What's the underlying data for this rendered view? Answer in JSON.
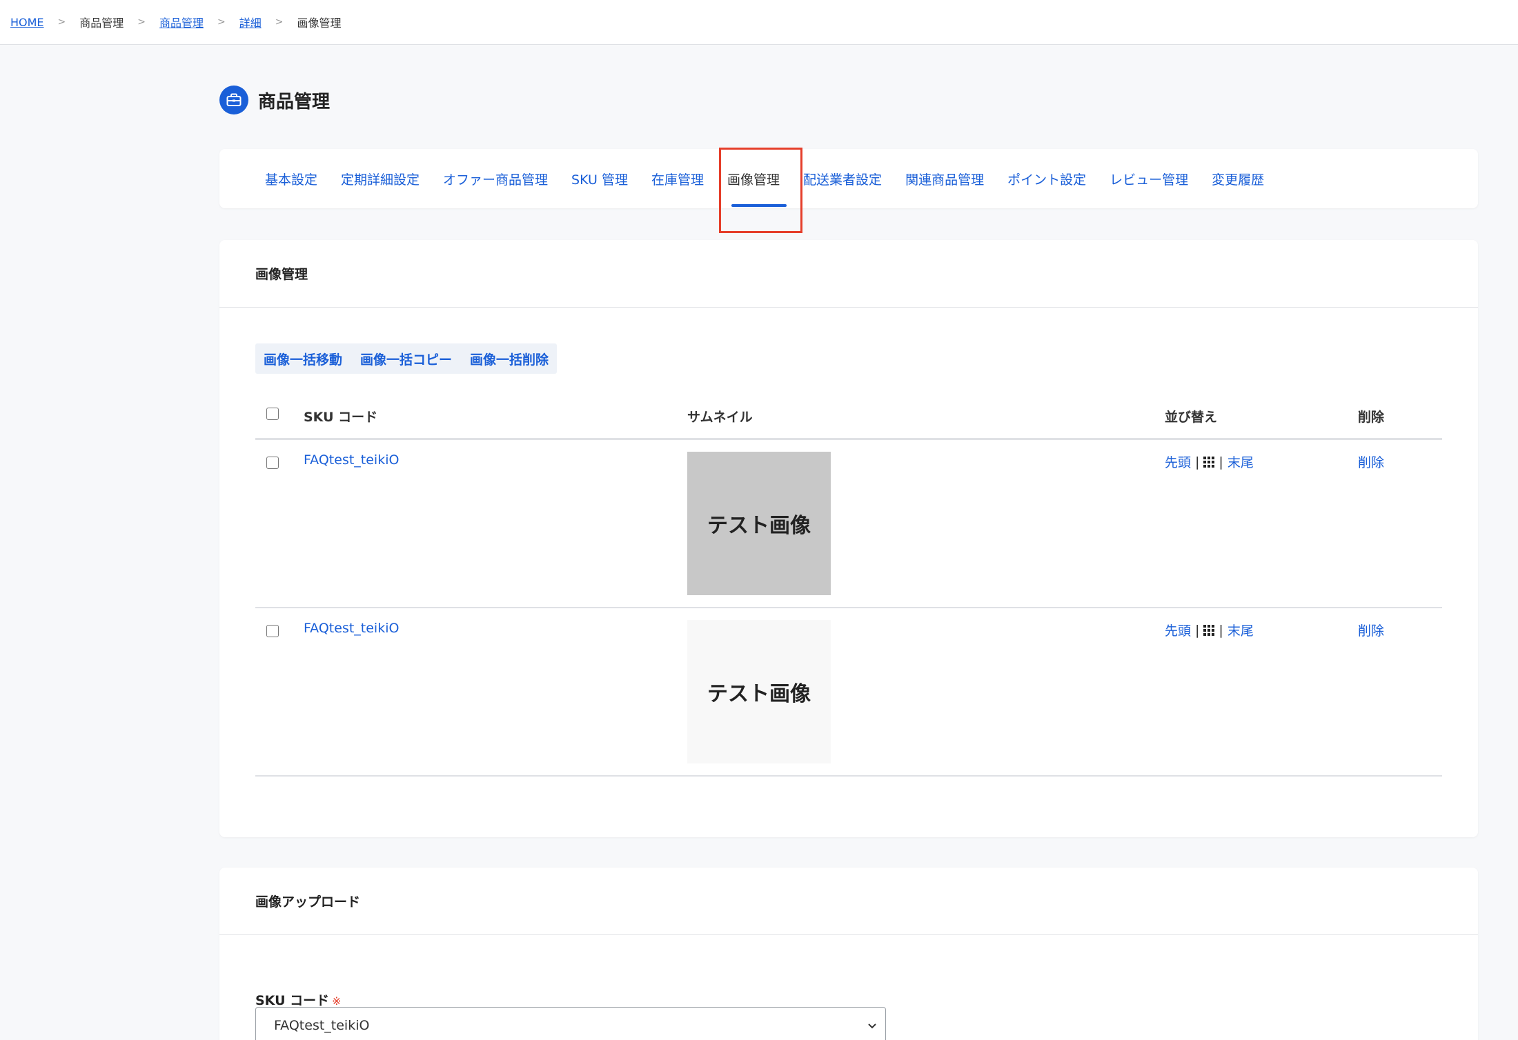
{
  "breadcrumb": {
    "home": "HOME",
    "sep": ">",
    "item1": "商品管理",
    "item2": "商品管理",
    "item3": "詳細",
    "item4": "画像管理"
  },
  "page": {
    "title": "商品管理",
    "icon": "briefcase-icon"
  },
  "tabs": [
    {
      "label": "基本設定"
    },
    {
      "label": "定期詳細設定"
    },
    {
      "label": "オファー商品管理"
    },
    {
      "label": "SKU 管理"
    },
    {
      "label": "在庫管理"
    },
    {
      "label": "画像管理"
    },
    {
      "label": "配送業者設定"
    },
    {
      "label": "関連商品管理"
    },
    {
      "label": "ポイント設定"
    },
    {
      "label": "レビュー管理"
    },
    {
      "label": "変更履歴"
    }
  ],
  "image_section": {
    "title": "画像管理",
    "bulk_move": "画像一括移動",
    "bulk_copy": "画像一括コピー",
    "bulk_delete": "画像一括削除",
    "headers": {
      "sku": "SKU コード",
      "thumb": "サムネイル",
      "sort": "並び替え",
      "delete": "削除"
    },
    "rows": [
      {
        "sku": "FAQtest_teikiO",
        "thumb_text": "テスト画像",
        "first": "先頭",
        "last": "末尾",
        "delete": "削除",
        "sep": "|"
      },
      {
        "sku": "FAQtest_teikiO",
        "thumb_text": "テスト画像",
        "first": "先頭",
        "last": "末尾",
        "delete": "削除",
        "sep": "|"
      }
    ]
  },
  "upload_section": {
    "title": "画像アップロード",
    "sku_label": "SKU コード",
    "required_mark": "※",
    "sku_value": "FAQtest_teikiO"
  },
  "colors": {
    "accent": "#1a5fd8",
    "highlight": "#e53e2a"
  }
}
